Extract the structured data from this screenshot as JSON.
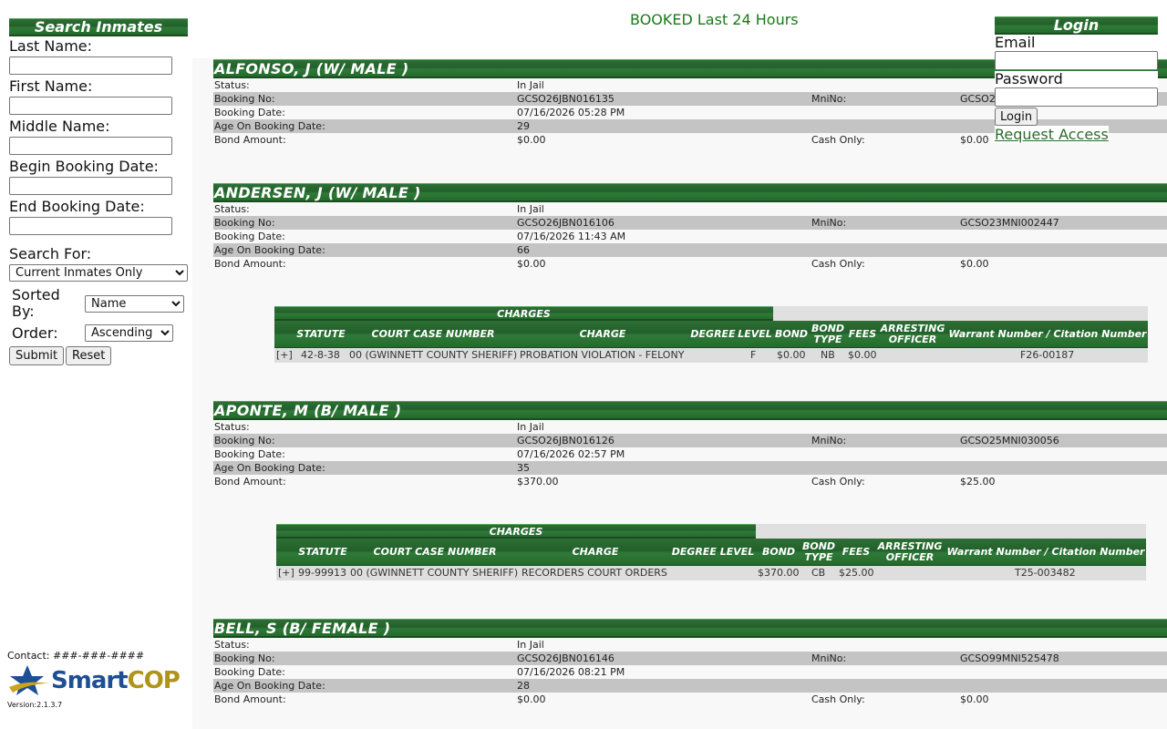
{
  "sidebar": {
    "title": "Search Inmates",
    "fields": {
      "last_name": {
        "label": "Last Name:",
        "value": ""
      },
      "first_name": {
        "label": "First Name:",
        "value": ""
      },
      "middle_name": {
        "label": "Middle Name:",
        "value": ""
      },
      "begin_date": {
        "label": "Begin Booking Date:",
        "value": ""
      },
      "end_date": {
        "label": "End Booking Date:",
        "value": ""
      }
    },
    "search_for": {
      "label": "Search For:",
      "selected": "Current Inmates Only"
    },
    "sorted_by": {
      "label": "Sorted By:",
      "selected": "Name"
    },
    "order": {
      "label": "Order:",
      "selected": "Ascending"
    },
    "submit_label": "Submit",
    "reset_label": "Reset",
    "contact": "Contact: ###-###-####",
    "logo": {
      "smart": "Smart",
      "cop": "COP"
    },
    "version": "Version:2.1.3.7"
  },
  "page_heading": "BOOKED Last 24 Hours",
  "labels": {
    "status": "Status:",
    "booking_no": "Booking No:",
    "mni_no": "MniNo:",
    "booking_date": "Booking Date:",
    "age": "Age On Booking Date:",
    "bond_amount": "Bond Amount:",
    "cash_only": "Cash Only:"
  },
  "charges_columns": {
    "title": "CHARGES",
    "statute": "STATUTE",
    "court_case": "COURT CASE NUMBER",
    "charge": "CHARGE",
    "degree": "DEGREE",
    "level": "LEVEL",
    "bond": "BOND",
    "bond_type": "BOND TYPE",
    "fees": "FEES",
    "officer": "ARRESTING OFFICER",
    "warrant": "Warrant Number / Citation Number"
  },
  "inmates": [
    {
      "name": "ALFONSO, J   (W/ MALE )",
      "status": "In Jail",
      "booking_no": "GCSO26JBN016135",
      "mni_no": "GCSO2",
      "booking_date": "07/16/2026 05:28 PM",
      "age": "29",
      "bond_amount": "$0.00",
      "cash_only": "$0.00"
    },
    {
      "name": "ANDERSEN, J   (W/ MALE )",
      "status": "In Jail",
      "booking_no": "GCSO26JBN016106",
      "mni_no": "GCSO23MNI002447",
      "booking_date": "07/16/2026 11:43 AM",
      "age": "66",
      "bond_amount": "$0.00",
      "cash_only": "$0.00",
      "charge": {
        "expand": "[+]",
        "statute": "42-8-38",
        "court_case": "00 (GWINNETT COUNTY SHERIFF)",
        "charge": "PROBATION VIOLATION - FELONY",
        "degree": "F",
        "bond": "$0.00",
        "bond_type": "NB",
        "fees": "$0.00",
        "warrant": "F26-00187"
      }
    },
    {
      "name": "APONTE, M   (B/ MALE )",
      "status": "In Jail",
      "booking_no": "GCSO26JBN016126",
      "mni_no": "GCSO25MNI030056",
      "booking_date": "07/16/2026 02:57 PM",
      "age": "35",
      "bond_amount": "$370.00",
      "cash_only": "$25.00",
      "charge": {
        "expand": "[+]",
        "statute": "99-99913",
        "court_case": "00 (GWINNETT COUNTY SHERIFF)",
        "charge": "RECORDERS COURT ORDERS",
        "degree": "",
        "bond": "$370.00",
        "bond_type": "CB",
        "fees": "$25.00",
        "warrant": "T25-003482"
      }
    },
    {
      "name": "BELL, S   (B/ FEMALE )",
      "status": "In Jail",
      "booking_no": "GCSO26JBN016146",
      "mni_no": "GCSO99MNI525478",
      "booking_date": "07/16/2026 08:21 PM",
      "age": "28",
      "bond_amount": "$0.00",
      "cash_only": "$0.00"
    }
  ],
  "login": {
    "title": "Login",
    "email_label": "Email",
    "email_value": "",
    "password_label": "Password",
    "password_value": "",
    "button_label": "Login",
    "request_access": "Request Access"
  }
}
